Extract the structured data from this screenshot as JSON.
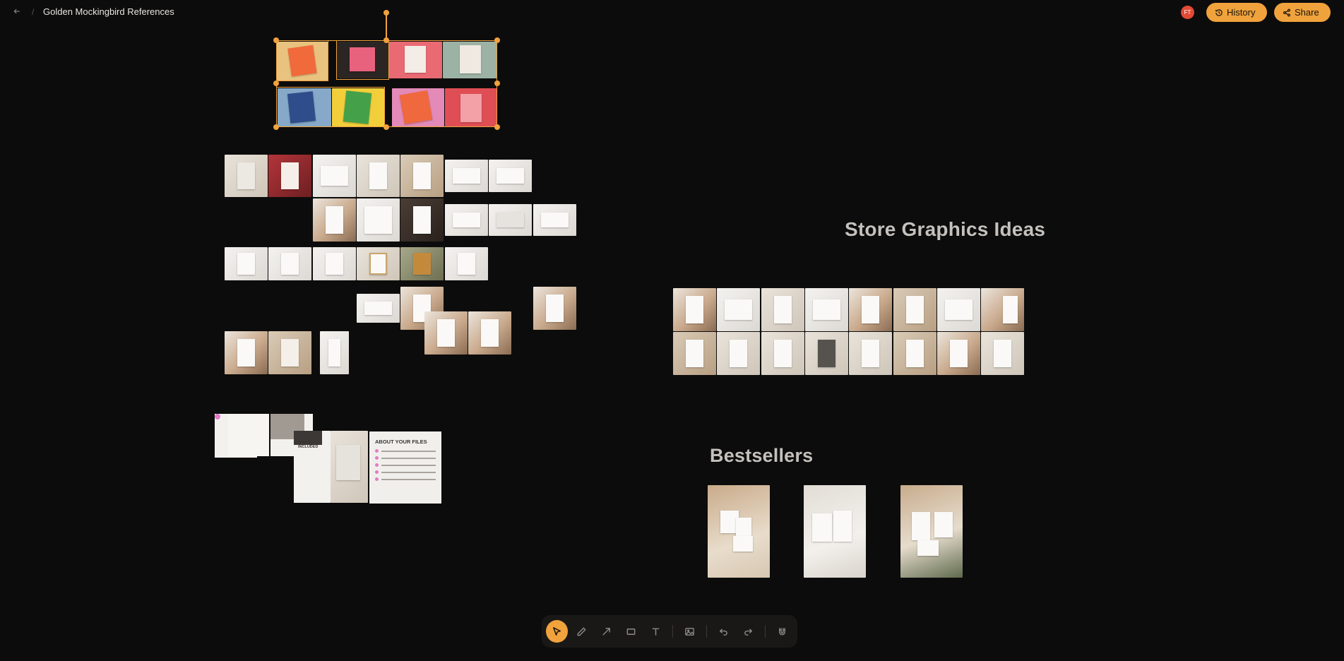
{
  "header": {
    "back_icon": "arrow-left-icon",
    "separator": "/",
    "title": "Golden Mockingbird References",
    "avatar_initials": "FT",
    "history_label": "History",
    "share_label": "Share"
  },
  "sections": {
    "store_graphics": "Store Graphics Ideas",
    "bestsellers": "Bestsellers"
  },
  "about_card": {
    "heading": "ABOUT YOUR FILES"
  },
  "small_cards": {
    "whats_included": "WHAT'S INCLUDED"
  },
  "toolbar": {
    "tools": [
      "select-tool",
      "pen-tool",
      "arrow-tool",
      "rectangle-tool",
      "text-tool",
      "image-tool",
      "undo-button",
      "redo-button",
      "magnet-tool"
    ]
  },
  "colors": {
    "accent": "#f0a23c",
    "background": "#0d0c0c",
    "avatar": "#e24a36"
  }
}
